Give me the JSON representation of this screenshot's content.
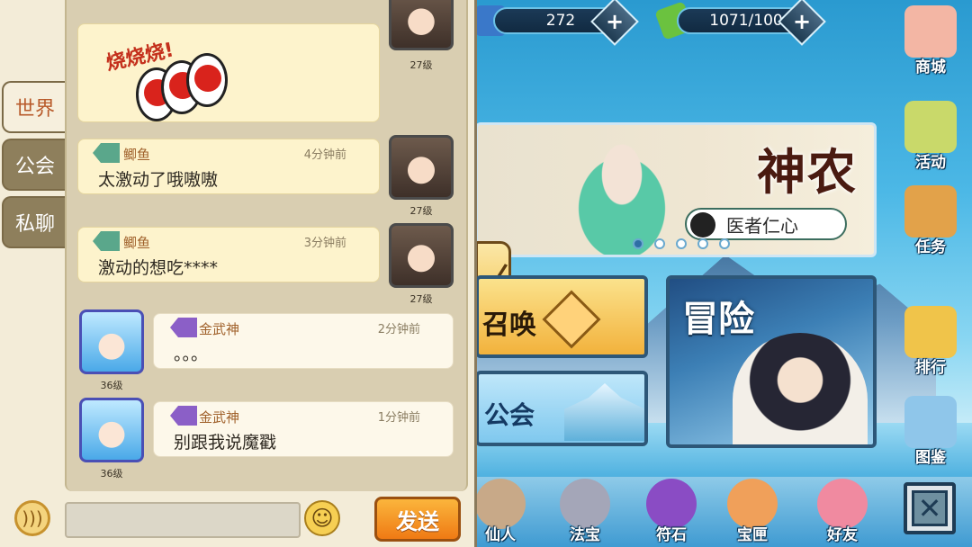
{
  "resources": {
    "gems": "272",
    "stamina": "1071/100",
    "plus": "+"
  },
  "banner": {
    "title": "神农",
    "subtitle": "医者仁心",
    "page_count": 5,
    "active_page": 0
  },
  "collapse_arrow": "〈",
  "main_buttons": {
    "summon": "召唤",
    "guild": "公会",
    "adventure": "冒险"
  },
  "right_menu": [
    {
      "label": "商城",
      "icon": "shop-cat-icon",
      "color": "#f3b6a4"
    },
    {
      "label": "活动",
      "icon": "gift-box-icon",
      "color": "#c9d96a"
    },
    {
      "label": "任务",
      "icon": "scroll-bag-icon",
      "color": "#e2a24a"
    },
    {
      "label": "排行",
      "icon": "trophy-icon",
      "color": "#f0c44a"
    },
    {
      "label": "图鉴",
      "icon": "book-icon",
      "color": "#8fc6ea"
    }
  ],
  "dock": [
    {
      "label": "仙人",
      "icon": "immortal-icon",
      "color": "#c8a988"
    },
    {
      "label": "法宝",
      "icon": "treasure-tool-icon",
      "color": "#a4a6b8"
    },
    {
      "label": "符石",
      "icon": "rune-stone-icon",
      "color": "#8a4cc4"
    },
    {
      "label": "宝匣",
      "icon": "treasure-box-icon",
      "color": "#f0a05a"
    },
    {
      "label": "好友",
      "icon": "friends-icon",
      "color": "#f08aa0"
    }
  ],
  "close_symbol": "✕",
  "chat": {
    "tabs": [
      {
        "label": "世界",
        "active": true
      },
      {
        "label": "公会",
        "active": false
      },
      {
        "label": "私聊",
        "active": false
      }
    ],
    "sticker_text": "烧烧烧!",
    "sticker_level": "27级",
    "messages": [
      {
        "name": "鲫鱼",
        "time": "4分钟前",
        "text": "太激动了哦嗷嗷",
        "level": "27级",
        "side": "right"
      },
      {
        "name": "鲫鱼",
        "time": "3分钟前",
        "text": "激动的想吃****",
        "level": "27级",
        "side": "right"
      },
      {
        "name": "金武神",
        "time": "2分钟前",
        "text": "。。。",
        "level": "36级",
        "side": "left"
      },
      {
        "name": "金武神",
        "time": "1分钟前",
        "text": "别跟我说魔戳",
        "level": "36级",
        "side": "left"
      }
    ],
    "input_value": "",
    "send_label": "发送",
    "voice_glyph": ")))",
    "emoji_glyph": "☺"
  }
}
